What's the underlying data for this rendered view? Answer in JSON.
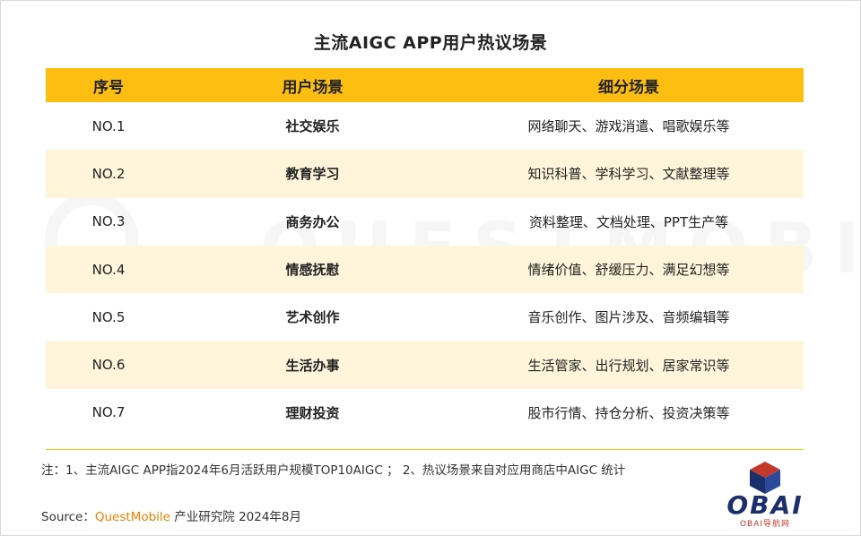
{
  "title": "主流AIGC APP用户热议场景",
  "table": {
    "headers": [
      "序号",
      "用户场景",
      "细分场景"
    ],
    "rows": [
      {
        "no": "NO.1",
        "scene": "社交娱乐",
        "detail": "网络聊天、游戏消遣、唱歌娱乐等"
      },
      {
        "no": "NO.2",
        "scene": "教育学习",
        "detail": "知识科普、学科学习、文献整理等"
      },
      {
        "no": "NO.3",
        "scene": "商务办公",
        "detail": "资料整理、文档处理、PPT生产等"
      },
      {
        "no": "NO.4",
        "scene": "情感抚慰",
        "detail": "情绪价值、舒缓压力、满足幻想等"
      },
      {
        "no": "NO.5",
        "scene": "艺术创作",
        "detail": "音乐创作、图片涉及、音频编辑等"
      },
      {
        "no": "NO.6",
        "scene": "生活办事",
        "detail": "生活管家、出行规划、居家常识等"
      },
      {
        "no": "NO.7",
        "scene": "理财投资",
        "detail": "股市行情、持仓分析、投资决策等"
      }
    ]
  },
  "note": "注：1、主流AIGC APP指2024年6月活跃用户规模TOP10AIGC ； 2、热议场景来自对应用商店中AIGC 统计",
  "source": {
    "label": "Source：",
    "brand": "QuestMobile",
    "rest": " 产业研究院 2024年8月"
  },
  "watermark": "QUESTMOBILE",
  "logo": {
    "text": "OBAI",
    "sub": "OBAI导航网"
  },
  "colors": {
    "header": "#FDBE12",
    "alt_row": "#FEF5DB",
    "brand": "#F08300"
  }
}
